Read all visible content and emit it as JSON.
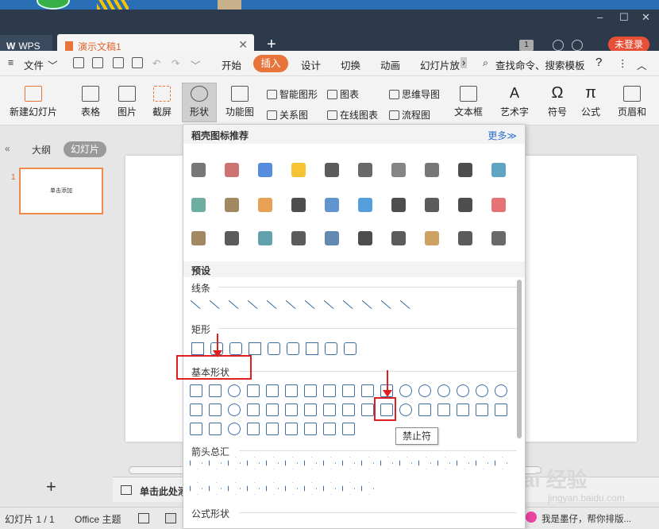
{
  "titlebar": {
    "wps_tab": "WPS",
    "doc_tab": "演示文稿1",
    "badge_count": "1",
    "login_button": "未登录"
  },
  "menubar": {
    "file": "文件",
    "tabs": [
      "开始",
      "插入",
      "设计",
      "切换",
      "动画",
      "幻灯片放"
    ],
    "search": "查找命令、搜索模板",
    "help": "?",
    "more": "⋮"
  },
  "ribbon": {
    "new_slide": "新建幻灯片",
    "table": "表格",
    "picture": "图片",
    "screenshot": "截屏",
    "shape": "形状",
    "function_chart": "功能图",
    "smart_shape": "智能图形",
    "chart": "图表",
    "relation": "关系图",
    "online_chart": "在线图表",
    "mindmap": "思维导图",
    "flowchart": "流程图",
    "textbox": "文本框",
    "wordart": "艺术字",
    "symbol": "符号",
    "formula": "公式",
    "header_footer": "页眉和"
  },
  "leftpanel": {
    "tab_outline": "大纲",
    "tab_slides": "幻灯片",
    "slide_number": "1",
    "slide_thumb_text": "单击添加"
  },
  "dropdown": {
    "title": "稻壳图标推荐",
    "more": "更多≫",
    "presets": "预设",
    "lines": "线条",
    "rectangles": "矩形",
    "basic_shapes": "基本形状",
    "arrows": "箭头总汇",
    "formula_shapes": "公式形状",
    "tooltip": "禁止符"
  },
  "notes": {
    "placeholder": "单击此处添"
  },
  "statusbar": {
    "slide_info": "幻灯片 1 / 1",
    "theme": "Office 主题",
    "assistant": "我是墨仔，帮你排版..."
  },
  "watermark": {
    "logo": "Bai 经验",
    "url": "jingyan.baidu.com"
  }
}
